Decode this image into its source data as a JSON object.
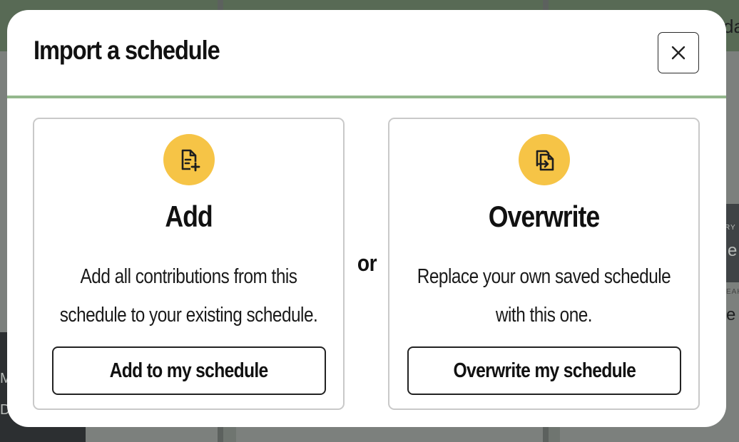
{
  "background": {
    "top_right_fragment": "da",
    "right_fragment_1_label": "RY",
    "right_fragment_1_text": "e C",
    "right_fragment_2_label": "EAK",
    "right_fragment_2_text": "e B",
    "left_fragment_1": "M",
    "left_fragment_2": "De"
  },
  "modal": {
    "title": "Import a schedule",
    "close_label": "×",
    "accent_color": "#94b88d",
    "separator_text": "or",
    "options": [
      {
        "icon": "file-plus-icon",
        "title": "Add",
        "description_line1": "Add all contributions from this",
        "description_line2": "schedule to your existing schedule.",
        "button_label": "Add to my schedule"
      },
      {
        "icon": "file-import-icon",
        "title": "Overwrite",
        "description_line1": "Replace your own saved schedule",
        "description_line2": "with this one.",
        "button_label": "Overwrite my schedule"
      }
    ],
    "icon_circle_color": "#f6c446"
  }
}
